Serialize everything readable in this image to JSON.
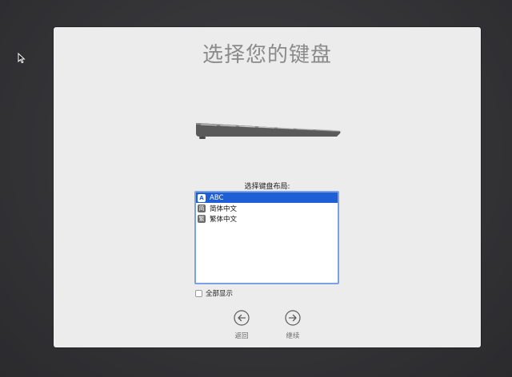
{
  "setup": {
    "title": "选择您的键盘",
    "layout_prompt": "选择键盘布局:",
    "layouts": [
      {
        "label": "ABC",
        "icon": "abc-icon",
        "icon_glyph": "A",
        "selected": true
      },
      {
        "label": "简体中文",
        "icon": "simplified-chinese-icon",
        "icon_glyph": "简",
        "selected": false
      },
      {
        "label": "繁体中文",
        "icon": "traditional-chinese-icon",
        "icon_glyph": "繁",
        "selected": false
      }
    ],
    "show_all_label": "全部显示",
    "show_all_checked": false,
    "back_label": "返回",
    "continue_label": "继续"
  },
  "colors": {
    "background": "#333336",
    "panel": "#ececec",
    "selection": "#1f5fd6",
    "list_border": "#7aa1e6"
  }
}
